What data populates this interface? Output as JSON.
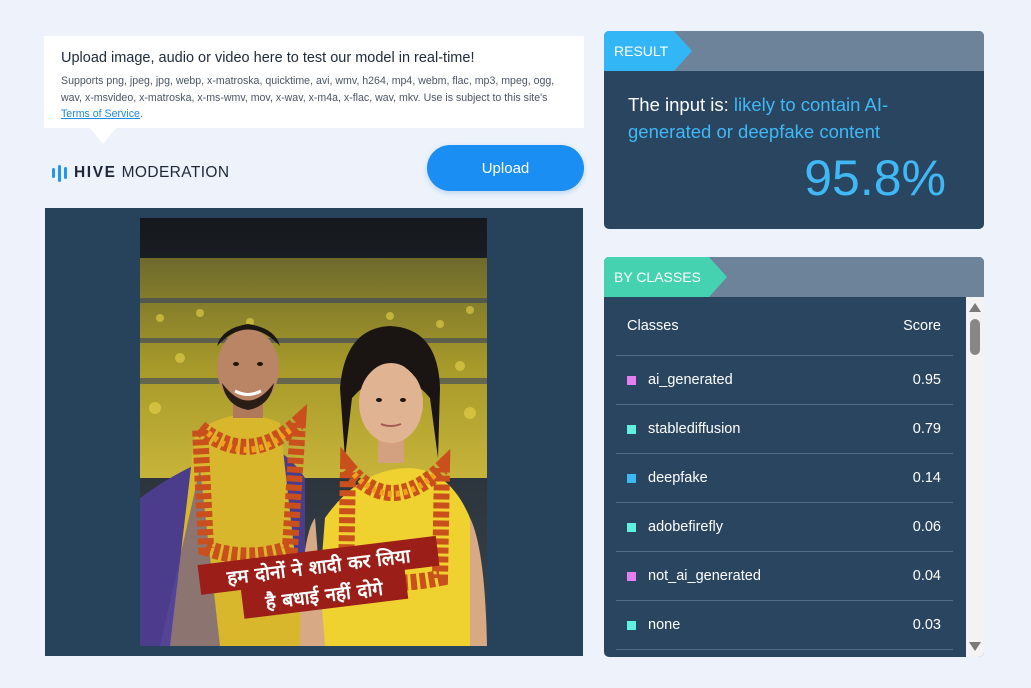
{
  "upload_info": {
    "title": "Upload image, audio or video here to test our model in real-time!",
    "supports_text": "Supports png, jpeg, jpg, webp, x-matroska, quicktime, avi, wmv, h264, mp4, webm, flac, mp3, mpeg, ogg, wav, x-msvideo, x-matroska, x-ms-wmv, mov, x-wav, x-m4a, x-flac, wav, mkv. Use is subject to this site's ",
    "terms_link": "Terms of Service",
    "terms_suffix": "."
  },
  "logo": {
    "icon": "hive-bars-icon",
    "brand": "HIVE",
    "product": "MODERATION"
  },
  "upload_button": {
    "label": "Upload"
  },
  "preview": {
    "caption_line1": "हम दोनों ने शादी कर लिया",
    "caption_line2": "है बधाई नहीं दोगे"
  },
  "result": {
    "tag": "RESULT",
    "prefix": "The input is: ",
    "verdict": "likely to contain AI-generated or deepfake content",
    "score": "95.8%"
  },
  "classes": {
    "tag": "BY CLASSES",
    "col_class": "Classes",
    "col_score": "Score",
    "rows": [
      {
        "name": "ai_generated",
        "score": "0.95",
        "color": "#e37ff0"
      },
      {
        "name": "stablediffusion",
        "score": "0.79",
        "color": "#5ff0e0"
      },
      {
        "name": "deepfake",
        "score": "0.14",
        "color": "#3cb8f2"
      },
      {
        "name": "adobefirefly",
        "score": "0.06",
        "color": "#5ff0e0"
      },
      {
        "name": "not_ai_generated",
        "score": "0.04",
        "color": "#e37ff0"
      },
      {
        "name": "none",
        "score": "0.03",
        "color": "#5ff0e0"
      }
    ]
  },
  "colors": {
    "accent": "#1a8ef2",
    "result_blue": "#3fb8f5",
    "panel_bg": "#2a4560",
    "classes_tag": "#45d2b0"
  }
}
